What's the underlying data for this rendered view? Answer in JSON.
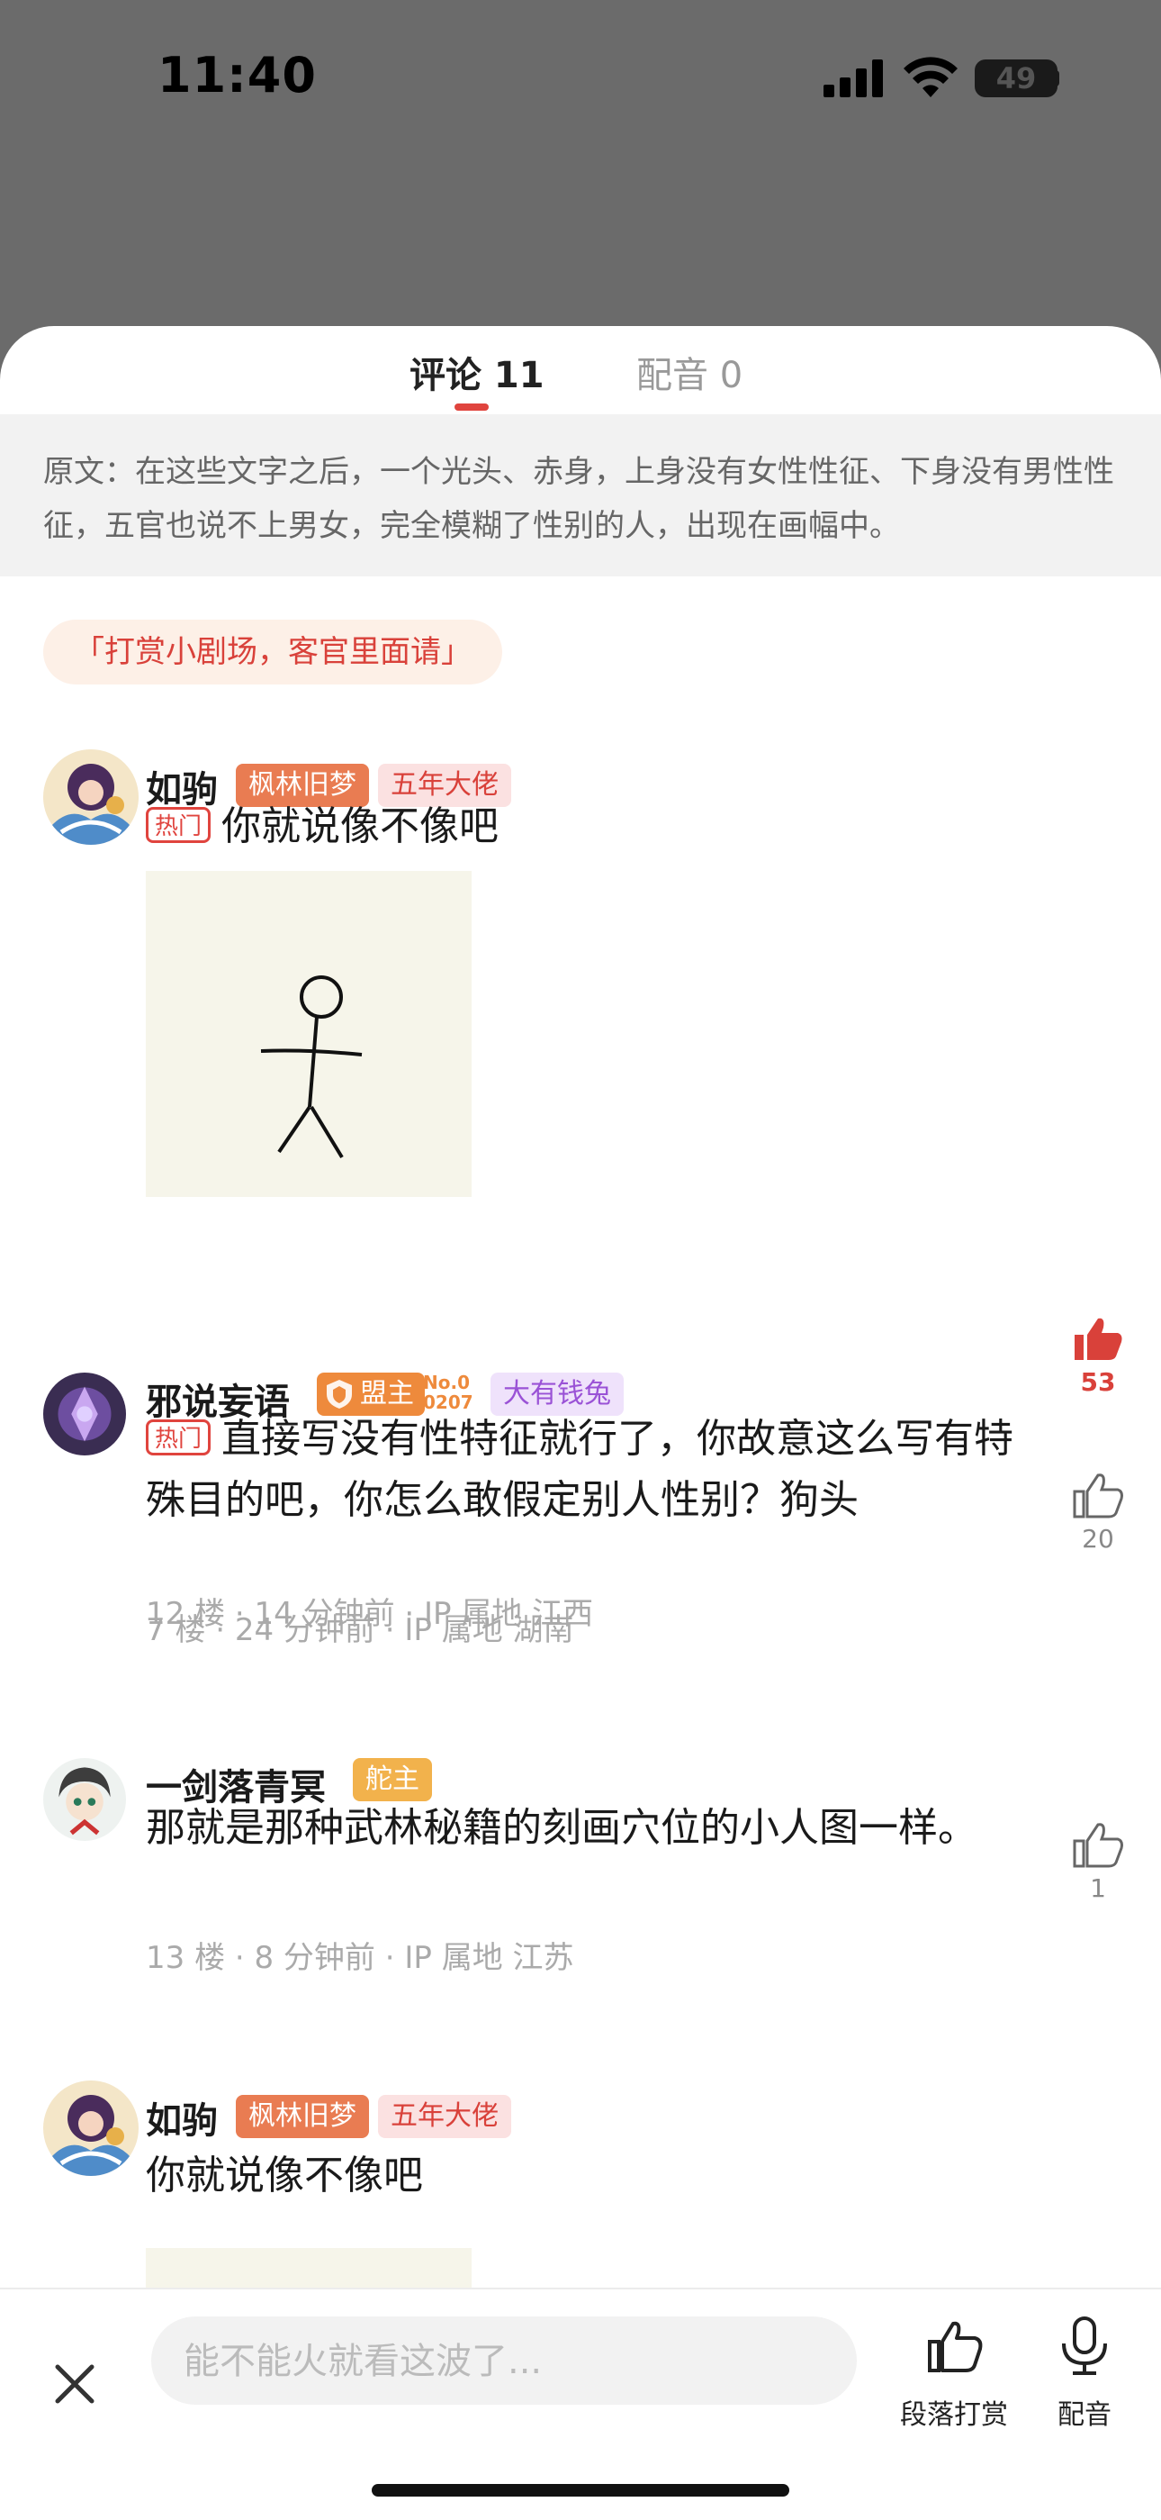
{
  "status": {
    "time": "11:40",
    "battery": "49"
  },
  "tabs": [
    {
      "label": "评论 11",
      "active": true
    },
    {
      "label": "配音 0",
      "active": false
    }
  ],
  "quote": "原文：在这些文字之后，一个光头、赤身，上身没有女性性征、下身没有男性性征，五官也说不上男女，完全模糊了性别的人，出现在画幅中。",
  "reward_tag": "「打赏小剧场，客官里面请」",
  "comments": [
    {
      "name": "如驹",
      "badges": [
        "枫林旧梦",
        "五年大佬"
      ],
      "hot": "热门",
      "text": "你就说像不像吧",
      "meta": "12 楼 · 14 分钟前 · IP 属地 江西",
      "likes": "53",
      "liked": true
    },
    {
      "name": "邪说妄语",
      "badges": [
        "盟主",
        "No.00207",
        "大有钱兔"
      ],
      "hot": "热门",
      "text": "直接写没有性特征就行了，你故意这么写有特殊目的吧，你怎么敢假定别人性别？狗头",
      "meta": "7 楼 · 24 分钟前 · IP 属地 湖南",
      "likes": "20",
      "liked": false
    },
    {
      "name": "一剑落青冥",
      "badges": [
        "舵主"
      ],
      "text": "那就是那种武林秘籍的刻画穴位的小人图一样。",
      "meta": "13 楼 · 8 分钟前 · IP 属地 江苏",
      "likes": "1",
      "liked": false
    },
    {
      "name": "如驹",
      "badges": [
        "枫林旧梦",
        "五年大佬"
      ],
      "text": "你就说像不像吧"
    }
  ],
  "bottom": {
    "input_placeholder": "能不能火就看这波了...",
    "reward_label": "段落打赏",
    "dub_label": "配音"
  },
  "colors": {
    "accent": "#e0443e",
    "overlay": "#6b6b6b"
  }
}
